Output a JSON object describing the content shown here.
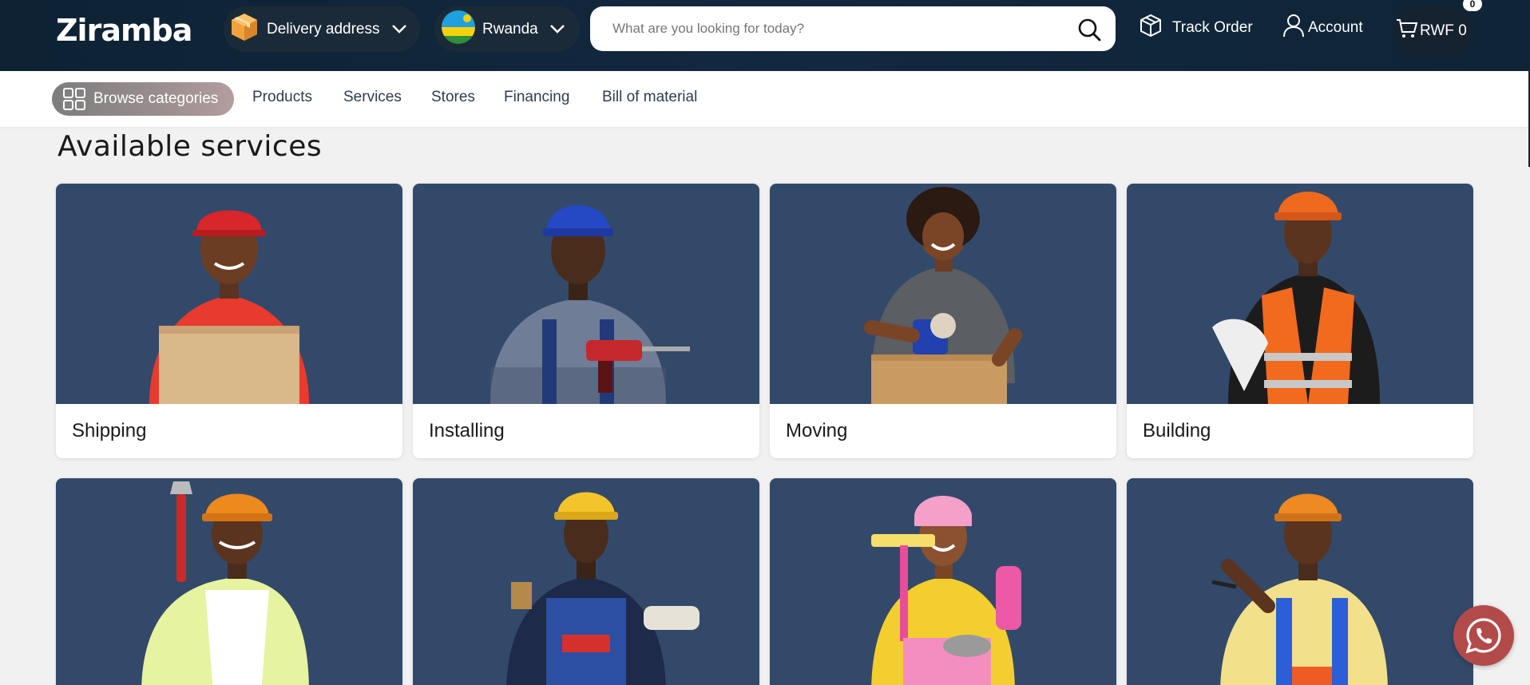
{
  "header": {
    "logo_text": "Ziramba",
    "delivery_label": "Delivery address",
    "country_label": "Rwanda",
    "search_placeholder": "What are you looking for today?",
    "track_order_label": "Track Order",
    "account_label": "Account",
    "cart_label": "RWF 0",
    "cart_count": "0"
  },
  "subnav": {
    "browse_label": "Browse categories",
    "links": [
      "Products",
      "Services",
      "Stores",
      "Financing",
      "Bill of material"
    ]
  },
  "main": {
    "title": "Available services",
    "services": [
      {
        "label": "Shipping",
        "icon": "person-with-box"
      },
      {
        "label": "Installing",
        "icon": "person-with-drill"
      },
      {
        "label": "Moving",
        "icon": "person-taping-box"
      },
      {
        "label": "Building",
        "icon": "person-with-blueprint"
      },
      {
        "label": "",
        "icon": "person-with-wrench"
      },
      {
        "label": "",
        "icon": "person-with-paintbrush"
      },
      {
        "label": "",
        "icon": "person-with-cleaning-supplies"
      },
      {
        "label": "",
        "icon": "person-pointing"
      }
    ]
  },
  "colors": {
    "header_bg": "#0e2234",
    "card_image_bg": "#33496a",
    "whatsapp_bg": "#b34a4a"
  }
}
